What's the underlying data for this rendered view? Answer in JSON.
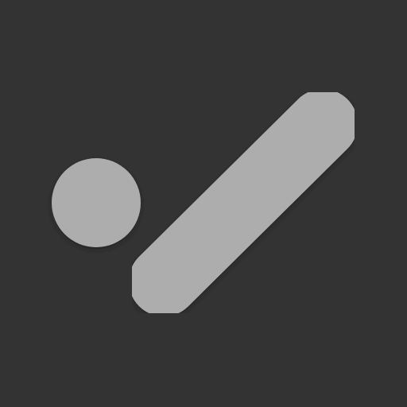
{
  "icon": {
    "name": "app-logo-icon",
    "description_parts": [
      "dot",
      "slash"
    ]
  },
  "colors": {
    "background": "#333333",
    "shape_fill": "#adadad",
    "shadow": "#1a1a1a"
  }
}
